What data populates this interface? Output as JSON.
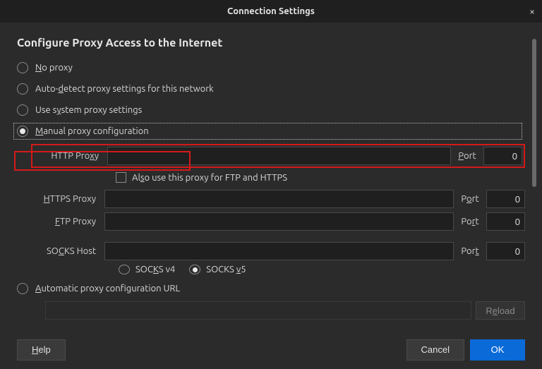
{
  "window": {
    "title": "Connection Settings",
    "close_glyph": "×"
  },
  "heading": "Configure Proxy Access to the Internet",
  "options": {
    "no_proxy": "No proxy",
    "auto_detect": "Auto-detect proxy settings for this network",
    "use_system_pre": "Use s",
    "use_system_u": "y",
    "use_system_post": "stem proxy settings",
    "manual_u": "M",
    "manual_post": "anual proxy configuration",
    "auto_pac_u": "A",
    "auto_pac_post": "utomatic proxy configuration URL"
  },
  "proxy": {
    "http_label_pre": "HTTP Pro",
    "http_label_u": "x",
    "http_label_post": "y",
    "http_value": "",
    "http_port_label_u": "P",
    "http_port_label_post": "ort",
    "http_port": "0",
    "also_use_pre": "Al",
    "also_use_u": "s",
    "also_use_post": "o use this proxy for FTP and HTTPS",
    "https_label_u": "H",
    "https_label_post": "TTPS Proxy",
    "https_value": "",
    "https_port_label_pre": "P",
    "https_port_label_u": "o",
    "https_port_label_post": "rt",
    "https_port": "0",
    "ftp_label_u": "F",
    "ftp_label_post": "TP Proxy",
    "ftp_value": "",
    "ftp_port_label_pre": "Po",
    "ftp_port_label_u": "r",
    "ftp_port_label_post": "t",
    "ftp_port": "0",
    "socks_label_pre": "SO",
    "socks_label_u": "C",
    "socks_label_post": "KS Host",
    "socks_value": "",
    "socks_port_label_pre": "Por",
    "socks_port_label_u": "t",
    "socks_port": "0",
    "socks_v4_pre": "SOC",
    "socks_v4_u": "K",
    "socks_v4_post": "S v4",
    "socks_v5_pre": "SOCKS ",
    "socks_v5_u": "v",
    "socks_v5_post": "5",
    "pac_value": "",
    "reload_label_pre": "R",
    "reload_label_u": "e",
    "reload_label_post": "load"
  },
  "footer": {
    "help": "Help",
    "cancel": "Cancel",
    "ok": "OK"
  }
}
